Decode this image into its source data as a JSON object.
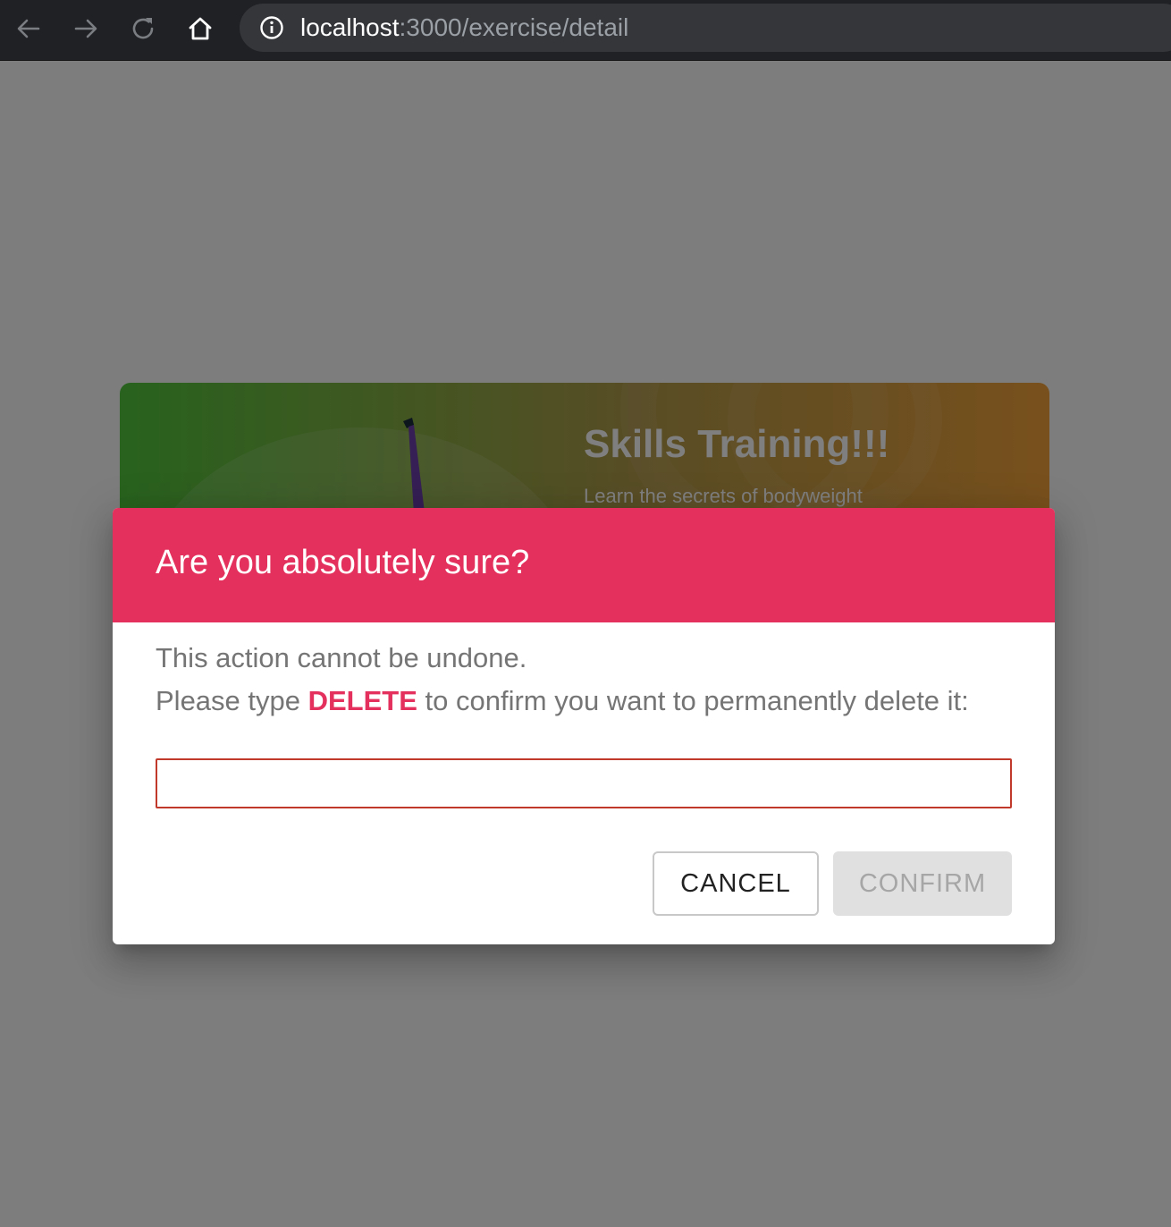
{
  "browser": {
    "url_host": "localhost",
    "url_path": ":3000/exercise/detail",
    "icons": [
      "back-arrow-icon",
      "forward-arrow-icon",
      "reload-icon",
      "home-icon",
      "info-icon"
    ]
  },
  "hero": {
    "title": "Skills Training!!!",
    "subtitle": "Learn the secrets of bodyweight"
  },
  "dialog": {
    "title": "Are you absolutely sure?",
    "line1": "This action cannot be undone.",
    "line2_prefix": "Please type ",
    "line2_keyword": "DELETE",
    "line2_suffix": " to confirm you want to permanently delete it:",
    "input_value": "",
    "cancel_label": "CANCEL",
    "confirm_label": "CONFIRM"
  },
  "colors": {
    "accent": "#e3305c",
    "input_border": "#c0392b",
    "disabled_bg": "#e0e0e0"
  }
}
